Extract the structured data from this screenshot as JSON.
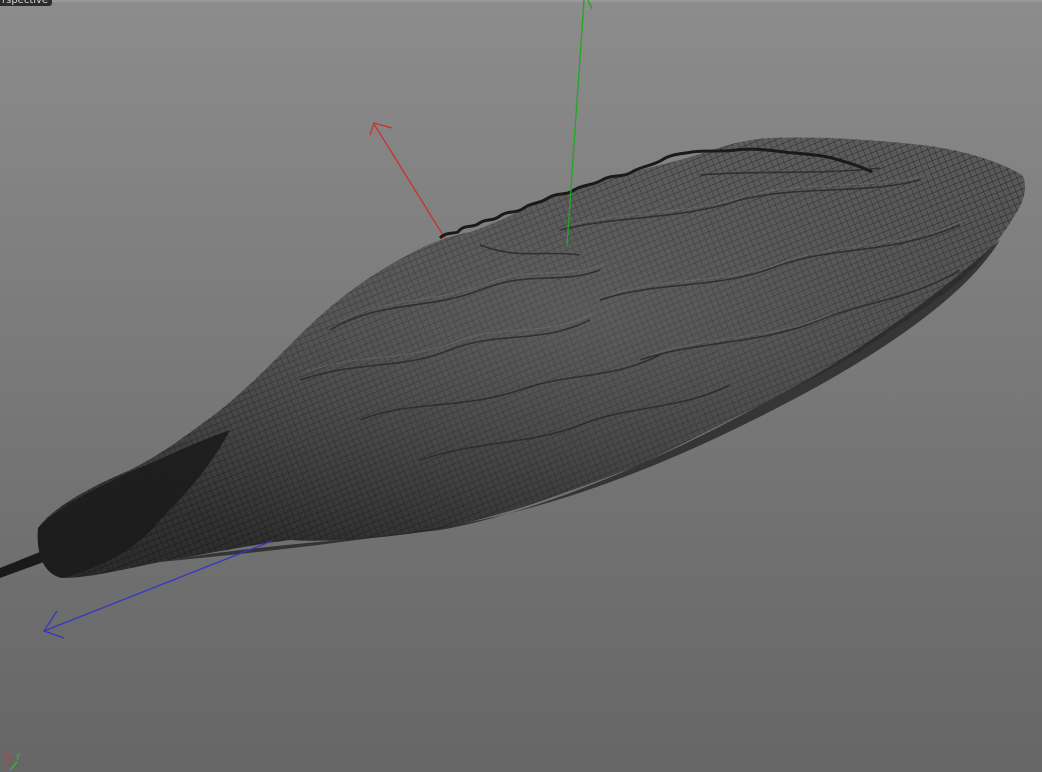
{
  "viewport": {
    "label": "rspective",
    "background_top": "#8c8c8c",
    "background_bottom": "#666666"
  },
  "model": {
    "description_icon": "wireframe-mesh-object",
    "fill_color": "#3a3a3a",
    "wire_color": "#1a1a1a"
  },
  "transform_gizmo": {
    "x_color": "#d03030",
    "y_color": "#20b020",
    "z_color": "#3030d0"
  },
  "axis_indicator": {
    "x_label": "X",
    "y_label": "Y",
    "x_color": "#d23a3a",
    "y_color": "#35c035"
  }
}
